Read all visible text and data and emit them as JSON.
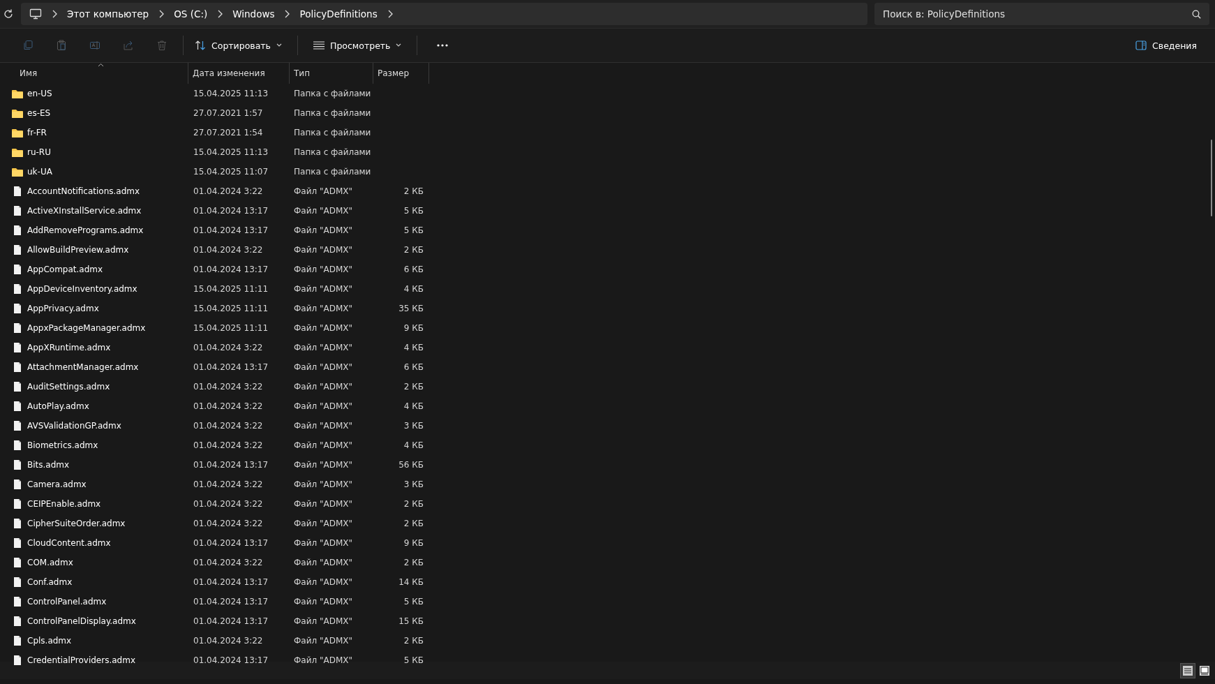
{
  "breadcrumb": [
    "Этот компьютер",
    "OS (C:)",
    "Windows",
    "PolicyDefinitions"
  ],
  "search": {
    "placeholder": "Поиск в: PolicyDefinitions"
  },
  "toolbar": {
    "sort": "Сортировать",
    "view": "Просмотреть",
    "details": "Сведения"
  },
  "columns": [
    "Имя",
    "Дата изменения",
    "Тип",
    "Размер"
  ],
  "rows": [
    {
      "kind": "folder",
      "name": "en-US",
      "date": "15.04.2025 11:13",
      "type": "Папка с файлами"
    },
    {
      "kind": "folder",
      "name": "es-ES",
      "date": "27.07.2021 1:57",
      "type": "Папка с файлами"
    },
    {
      "kind": "folder",
      "name": "fr-FR",
      "date": "27.07.2021 1:54",
      "type": "Папка с файлами"
    },
    {
      "kind": "folder",
      "name": "ru-RU",
      "date": "15.04.2025 11:13",
      "type": "Папка с файлами"
    },
    {
      "kind": "folder",
      "name": "uk-UA",
      "date": "15.04.2025 11:07",
      "type": "Папка с файлами"
    },
    {
      "kind": "file",
      "name": "AccountNotifications.admx",
      "date": "01.04.2024 3:22",
      "type": "Файл \"ADMX\"",
      "size": "2 КБ"
    },
    {
      "kind": "file",
      "name": "ActiveXInstallService.admx",
      "date": "01.04.2024 13:17",
      "type": "Файл \"ADMX\"",
      "size": "5 КБ"
    },
    {
      "kind": "file",
      "name": "AddRemovePrograms.admx",
      "date": "01.04.2024 13:17",
      "type": "Файл \"ADMX\"",
      "size": "5 КБ"
    },
    {
      "kind": "file",
      "name": "AllowBuildPreview.admx",
      "date": "01.04.2024 3:22",
      "type": "Файл \"ADMX\"",
      "size": "2 КБ"
    },
    {
      "kind": "file",
      "name": "AppCompat.admx",
      "date": "01.04.2024 13:17",
      "type": "Файл \"ADMX\"",
      "size": "6 КБ"
    },
    {
      "kind": "file",
      "name": "AppDeviceInventory.admx",
      "date": "15.04.2025 11:11",
      "type": "Файл \"ADMX\"",
      "size": "4 КБ"
    },
    {
      "kind": "file",
      "name": "AppPrivacy.admx",
      "date": "15.04.2025 11:11",
      "type": "Файл \"ADMX\"",
      "size": "35 КБ"
    },
    {
      "kind": "file",
      "name": "AppxPackageManager.admx",
      "date": "15.04.2025 11:11",
      "type": "Файл \"ADMX\"",
      "size": "9 КБ"
    },
    {
      "kind": "file",
      "name": "AppXRuntime.admx",
      "date": "01.04.2024 3:22",
      "type": "Файл \"ADMX\"",
      "size": "4 КБ"
    },
    {
      "kind": "file",
      "name": "AttachmentManager.admx",
      "date": "01.04.2024 13:17",
      "type": "Файл \"ADMX\"",
      "size": "6 КБ"
    },
    {
      "kind": "file",
      "name": "AuditSettings.admx",
      "date": "01.04.2024 3:22",
      "type": "Файл \"ADMX\"",
      "size": "2 КБ"
    },
    {
      "kind": "file",
      "name": "AutoPlay.admx",
      "date": "01.04.2024 3:22",
      "type": "Файл \"ADMX\"",
      "size": "4 КБ"
    },
    {
      "kind": "file",
      "name": "AVSValidationGP.admx",
      "date": "01.04.2024 3:22",
      "type": "Файл \"ADMX\"",
      "size": "3 КБ"
    },
    {
      "kind": "file",
      "name": "Biometrics.admx",
      "date": "01.04.2024 3:22",
      "type": "Файл \"ADMX\"",
      "size": "4 КБ"
    },
    {
      "kind": "file",
      "name": "Bits.admx",
      "date": "01.04.2024 13:17",
      "type": "Файл \"ADMX\"",
      "size": "56 КБ"
    },
    {
      "kind": "file",
      "name": "Camera.admx",
      "date": "01.04.2024 3:22",
      "type": "Файл \"ADMX\"",
      "size": "3 КБ"
    },
    {
      "kind": "file",
      "name": "CEIPEnable.admx",
      "date": "01.04.2024 3:22",
      "type": "Файл \"ADMX\"",
      "size": "2 КБ"
    },
    {
      "kind": "file",
      "name": "CipherSuiteOrder.admx",
      "date": "01.04.2024 3:22",
      "type": "Файл \"ADMX\"",
      "size": "2 КБ"
    },
    {
      "kind": "file",
      "name": "CloudContent.admx",
      "date": "01.04.2024 13:17",
      "type": "Файл \"ADMX\"",
      "size": "9 КБ"
    },
    {
      "kind": "file",
      "name": "COM.admx",
      "date": "01.04.2024 3:22",
      "type": "Файл \"ADMX\"",
      "size": "2 КБ"
    },
    {
      "kind": "file",
      "name": "Conf.admx",
      "date": "01.04.2024 13:17",
      "type": "Файл \"ADMX\"",
      "size": "14 КБ"
    },
    {
      "kind": "file",
      "name": "ControlPanel.admx",
      "date": "01.04.2024 13:17",
      "type": "Файл \"ADMX\"",
      "size": "5 КБ"
    },
    {
      "kind": "file",
      "name": "ControlPanelDisplay.admx",
      "date": "01.04.2024 13:17",
      "type": "Файл \"ADMX\"",
      "size": "15 КБ"
    },
    {
      "kind": "file",
      "name": "Cpls.admx",
      "date": "01.04.2024 3:22",
      "type": "Файл \"ADMX\"",
      "size": "2 КБ"
    },
    {
      "kind": "file",
      "name": "CredentialProviders.admx",
      "date": "01.04.2024 13:17",
      "type": "Файл \"ADMX\"",
      "size": "5 КБ"
    }
  ],
  "view_modes": [
    {
      "kind": "details",
      "selected": true
    },
    {
      "kind": "tiles",
      "selected": false
    }
  ]
}
